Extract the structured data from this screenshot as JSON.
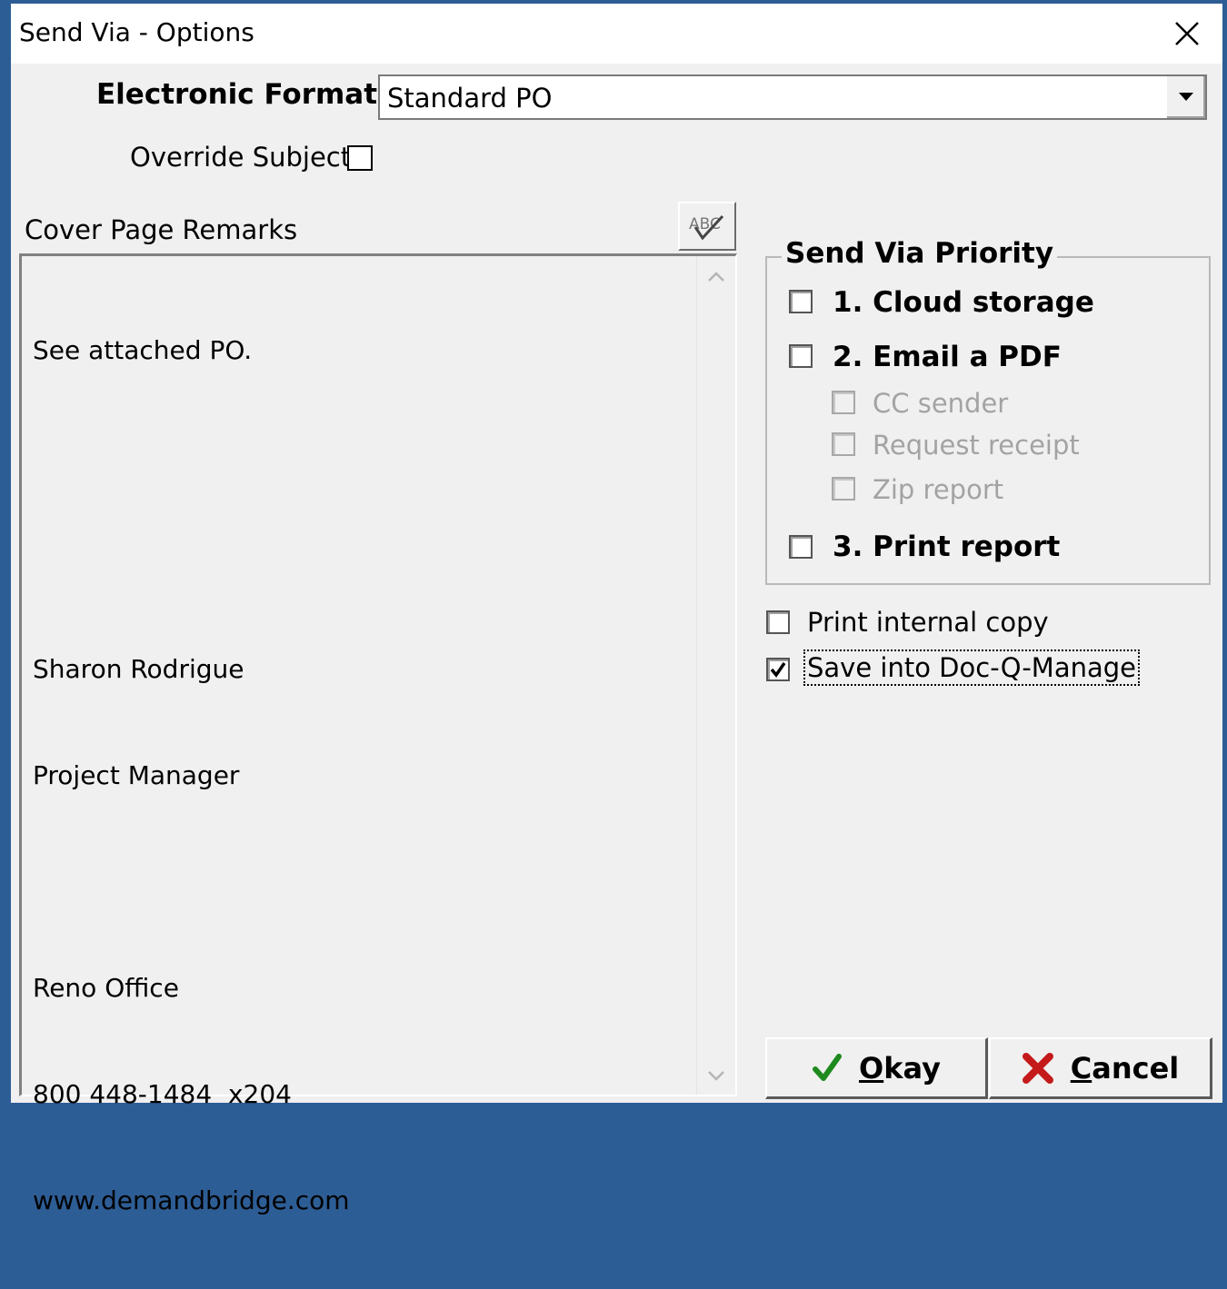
{
  "window": {
    "title": "Send Via - Options"
  },
  "electronic_format": {
    "label": "Electronic Format:",
    "value": "Standard PO"
  },
  "override_subject": {
    "label": "Override Subject",
    "checked": false
  },
  "cover_page": {
    "label": "Cover Page Remarks",
    "remarks_lines": [
      "See attached PO.",
      "",
      "",
      "Sharon Rodrigue",
      "Project Manager",
      "",
      "Reno Office",
      "800 448-1484  x204",
      "www.demandbridge.com"
    ],
    "spell_check_icon": "spell-check-icon"
  },
  "send_via_priority": {
    "title": "Send Via Priority",
    "cloud_storage": {
      "label": "1. Cloud storage",
      "checked": false
    },
    "email_pdf": {
      "label": "2. Email a PDF",
      "checked": false
    },
    "cc_sender": {
      "label": "CC sender",
      "checked": false,
      "enabled": false
    },
    "request_receipt": {
      "label": "Request receipt",
      "checked": false,
      "enabled": false
    },
    "zip_report": {
      "label": "Zip report",
      "checked": false,
      "enabled": false
    },
    "print_report": {
      "label": "3. Print report",
      "checked": false
    }
  },
  "print_internal_copy": {
    "label": "Print internal copy",
    "checked": false
  },
  "save_doc_q": {
    "label": "Save into Doc-Q-Manage",
    "checked": true
  },
  "buttons": {
    "okay": {
      "label": "Okay",
      "icon": "check-icon",
      "color": "#1e8a1e"
    },
    "cancel": {
      "label": "Cancel",
      "icon": "x-icon",
      "color": "#c41a1a"
    }
  }
}
